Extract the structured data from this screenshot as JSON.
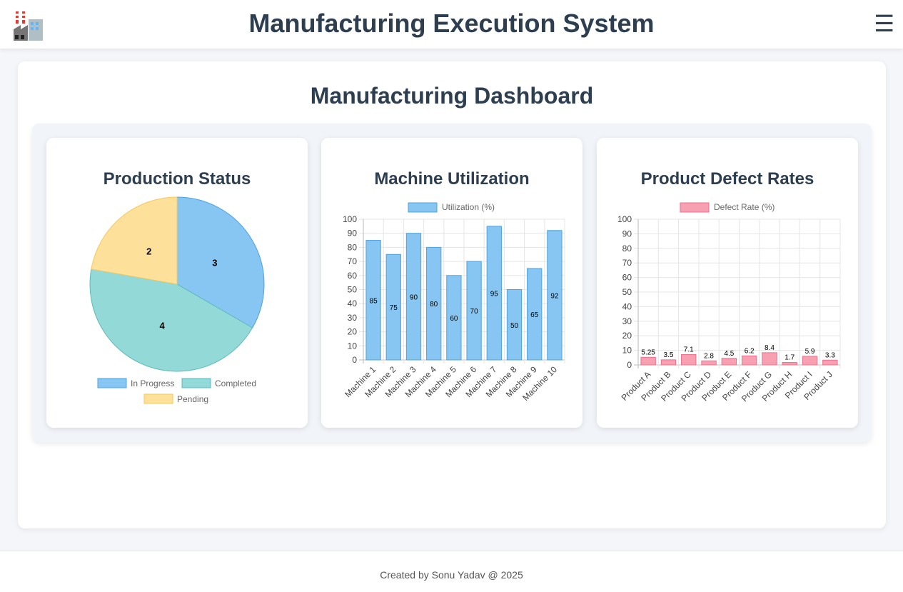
{
  "header": {
    "title": "Manufacturing Execution System",
    "logo_icon": "factory-icon",
    "menu_icon": "hamburger-menu-icon",
    "menu_glyph": "☰"
  },
  "dashboard": {
    "title": "Manufacturing Dashboard"
  },
  "cards": {
    "production": {
      "title": "Production Status"
    },
    "utilization": {
      "title": "Machine Utilization"
    },
    "defects": {
      "title": "Product Defect Rates"
    }
  },
  "colors": {
    "in_progress": "#87c5f2",
    "in_progress_border": "#4ea3de",
    "completed": "#93d9d8",
    "completed_border": "#5cbcbb",
    "pending": "#fde19b",
    "pending_border": "#f5c95a",
    "utilization": "#87c5f2",
    "utilization_border": "#4ea3de",
    "defect": "#f7a0b2",
    "defect_border": "#ef6f8c"
  },
  "chart_data": [
    {
      "type": "pie",
      "title": "Production Status",
      "categories": [
        "In Progress",
        "Completed",
        "Pending"
      ],
      "values": [
        3,
        4,
        2
      ],
      "legend": "bottom"
    },
    {
      "type": "bar",
      "title": "Machine Utilization",
      "categories": [
        "Machine 1",
        "Machine 2",
        "Machine 3",
        "Machine 4",
        "Machine 5",
        "Machine 6",
        "Machine 7",
        "Machine 8",
        "Machine 9",
        "Machine 10"
      ],
      "series": [
        {
          "name": "Utilization (%)",
          "values": [
            85,
            75,
            90,
            80,
            60,
            70,
            95,
            50,
            65,
            92
          ]
        }
      ],
      "ylim": [
        0,
        100
      ],
      "yticks": [
        0,
        10,
        20,
        30,
        40,
        50,
        60,
        70,
        80,
        90,
        100
      ],
      "grid": true,
      "legend": "top"
    },
    {
      "type": "bar",
      "title": "Product Defect Rates",
      "categories": [
        "Product A",
        "Product B",
        "Product C",
        "Product D",
        "Product E",
        "Product F",
        "Product G",
        "Product H",
        "Product I",
        "Product J"
      ],
      "series": [
        {
          "name": "Defect Rate (%)",
          "values": [
            5.25,
            3.5,
            7.1,
            2.8,
            4.5,
            6.2,
            8.4,
            1.7,
            5.9,
            3.3
          ]
        }
      ],
      "ylim": [
        0,
        100
      ],
      "yticks": [
        0,
        10,
        20,
        30,
        40,
        50,
        60,
        70,
        80,
        90,
        100
      ],
      "grid": true,
      "legend": "top"
    }
  ],
  "footer": {
    "text": "Created by Sonu Yadav @ 2025"
  }
}
